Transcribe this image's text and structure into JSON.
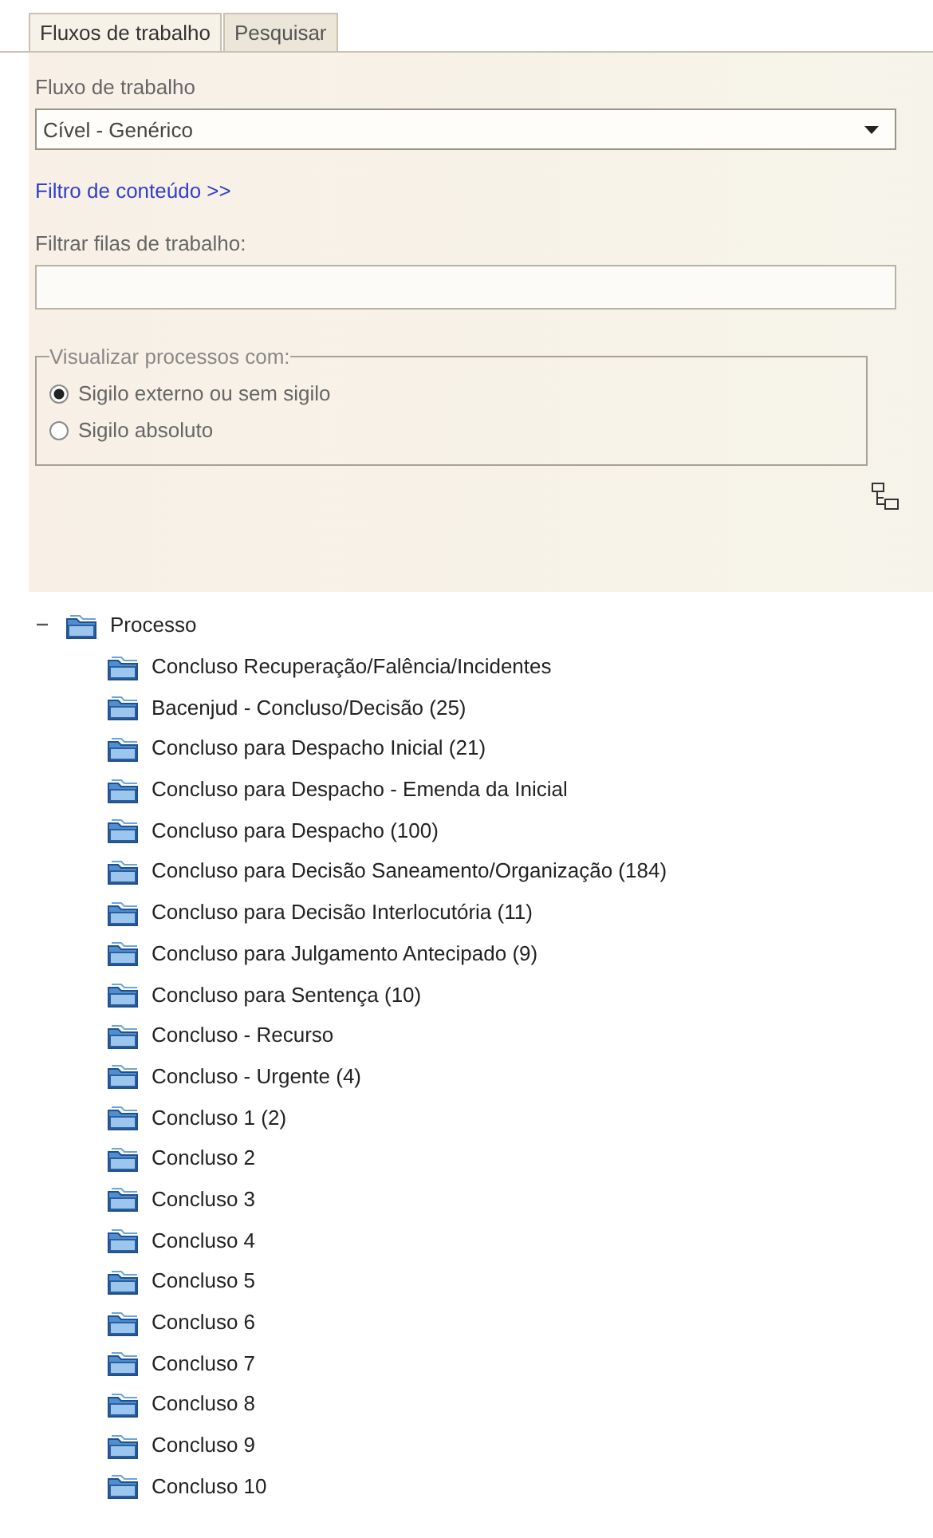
{
  "tabs": [
    {
      "label": "Fluxos de trabalho",
      "selected": true
    },
    {
      "label": "Pesquisar",
      "selected": false
    }
  ],
  "workflow": {
    "label": "Fluxo de trabalho",
    "value": "Cível - Genérico"
  },
  "content_filter_link": "Filtro de conteúdo >>",
  "queue_filter": {
    "label": "Filtrar filas de trabalho:"
  },
  "visibility": {
    "legend": "Visualizar processos com:",
    "options": [
      {
        "label": "Sigilo externo ou sem sigilo",
        "selected": true
      },
      {
        "label": "Sigilo absoluto",
        "selected": false
      }
    ]
  },
  "tree": [
    {
      "label": "Processo",
      "expanded": true,
      "children": [
        {
          "label": "Concluso Recuperação/Falência/Incidentes"
        },
        {
          "label": "Bacenjud - Concluso/Decisão (25)"
        },
        {
          "label": "Concluso para Despacho Inicial (21)"
        },
        {
          "label": "Concluso para Despacho - Emenda da Inicial"
        },
        {
          "label": "Concluso para Despacho (100)"
        },
        {
          "label": "Concluso para Decisão Saneamento/Organização (184)"
        },
        {
          "label": "Concluso para Decisão Interlocutória (11)"
        },
        {
          "label": "Concluso para Julgamento Antecipado (9)"
        },
        {
          "label": "Concluso para Sentença (10)"
        },
        {
          "label": "Concluso - Recurso"
        },
        {
          "label": "Concluso - Urgente (4)"
        },
        {
          "label": "Concluso 1 (2)"
        },
        {
          "label": "Concluso 2"
        },
        {
          "label": "Concluso 3"
        },
        {
          "label": "Concluso 4"
        },
        {
          "label": "Concluso 5"
        },
        {
          "label": "Concluso 6"
        },
        {
          "label": "Concluso 7"
        },
        {
          "label": "Concluso 8"
        },
        {
          "label": "Concluso 9"
        },
        {
          "label": "Concluso 10"
        }
      ]
    }
  ]
}
